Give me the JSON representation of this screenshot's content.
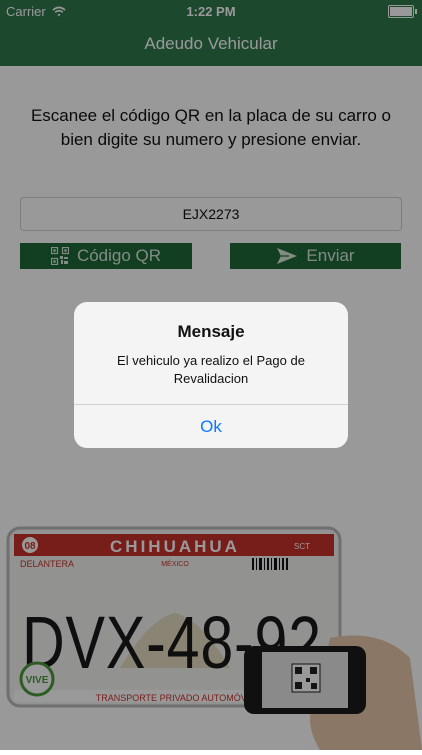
{
  "status_bar": {
    "carrier": "Carrier",
    "time": "1:22 PM"
  },
  "nav": {
    "title": "Adeudo Vehicular"
  },
  "main": {
    "instructions": "Escanee el código QR en la placa de su carro o bien digite su numero y presione enviar.",
    "plate_input_value": "EJX2273",
    "qr_button_label": "Código QR",
    "send_button_label": "Enviar"
  },
  "plate_image": {
    "state": "CHIHUAHUA",
    "country": "MÉXICO",
    "position_label": "DELANTERA",
    "code": "08",
    "number": "DVX-48-92",
    "footer": "TRANSPORTE PRIVADO AUTOMÓVIL",
    "badge": "VIVE",
    "agency": "SCT"
  },
  "alert": {
    "title": "Mensaje",
    "message": "El vehiculo ya realizo el Pago de Revalidacion",
    "ok_label": "Ok"
  },
  "colors": {
    "nav_green": "#2f7a4c",
    "button_green": "#1f6a37",
    "alert_blue": "#0a7aff"
  },
  "icons": [
    "wifi-icon",
    "battery-icon",
    "qr-code-icon",
    "send-arrow-icon",
    "phone-scanning-icon"
  ]
}
